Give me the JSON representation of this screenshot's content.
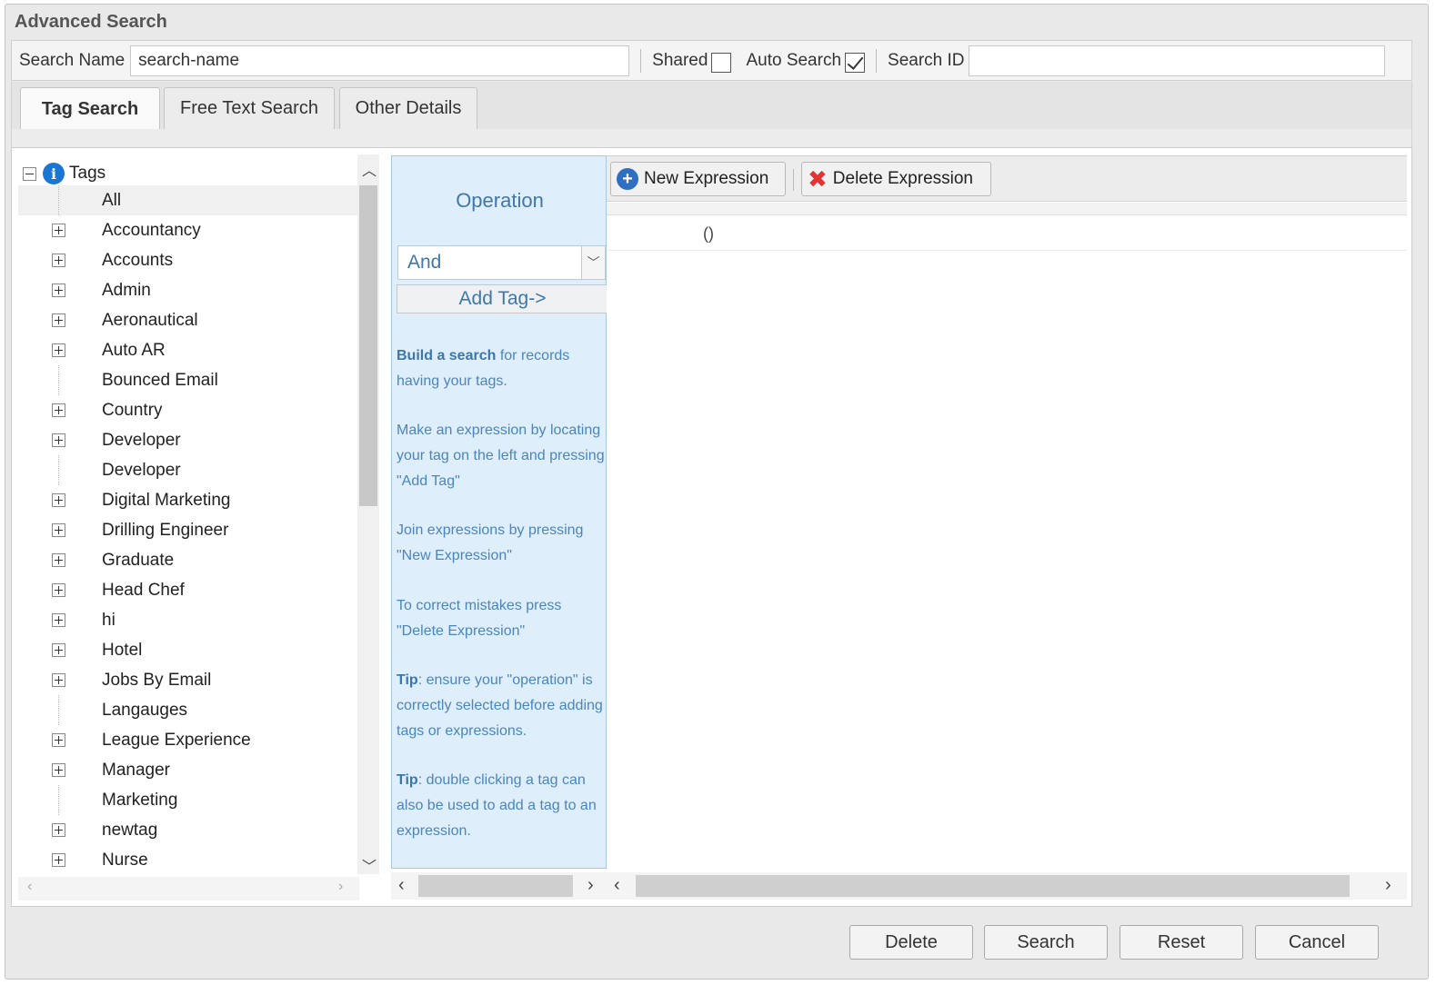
{
  "window": {
    "title": "Advanced Search"
  },
  "search_row": {
    "name_label": "Search Name",
    "name_value": "search-name",
    "shared_label": "Shared",
    "shared_checked": false,
    "auto_search_label": "Auto Search",
    "auto_search_checked": true,
    "search_id_label": "Search ID",
    "search_id_value": ""
  },
  "tabs": [
    {
      "label": "Tag Search",
      "active": true
    },
    {
      "label": "Free Text Search",
      "active": false
    },
    {
      "label": "Other Details",
      "active": false
    }
  ],
  "tree": {
    "root_label": "Tags",
    "items": [
      {
        "label": "All",
        "expandable": false,
        "selected": true
      },
      {
        "label": "Accountancy",
        "expandable": true
      },
      {
        "label": "Accounts",
        "expandable": true
      },
      {
        "label": "Admin",
        "expandable": true
      },
      {
        "label": "Aeronautical",
        "expandable": true
      },
      {
        "label": "Auto AR",
        "expandable": true
      },
      {
        "label": "Bounced Email",
        "expandable": false
      },
      {
        "label": "Country",
        "expandable": true
      },
      {
        "label": "Developer",
        "expandable": true
      },
      {
        "label": "Developer",
        "expandable": false
      },
      {
        "label": "Digital Marketing",
        "expandable": true
      },
      {
        "label": "Drilling Engineer",
        "expandable": true
      },
      {
        "label": "Graduate",
        "expandable": true
      },
      {
        "label": "Head Chef",
        "expandable": true
      },
      {
        "label": "hi",
        "expandable": true
      },
      {
        "label": "Hotel",
        "expandable": true
      },
      {
        "label": "Jobs By Email",
        "expandable": true
      },
      {
        "label": "Langauges",
        "expandable": false
      },
      {
        "label": "League Experience",
        "expandable": true
      },
      {
        "label": "Manager",
        "expandable": true
      },
      {
        "label": "Marketing",
        "expandable": false
      },
      {
        "label": "newtag",
        "expandable": true
      },
      {
        "label": "Nurse",
        "expandable": true
      }
    ]
  },
  "operation": {
    "title": "Operation",
    "selected": "And",
    "add_tag_label": "Add Tag->",
    "help": [
      {
        "bold": "Build a search",
        "text": " for records having your tags."
      },
      {
        "bold": "",
        "text": "Make an expression by locating your tag on the left and pressing \"Add Tag\""
      },
      {
        "bold": "",
        "text": "Join expressions by pressing \"New Expression\""
      },
      {
        "bold": "",
        "text": "To correct mistakes press \"Delete Expression\""
      },
      {
        "bold": "Tip",
        "text": ": ensure your \"operation\" is correctly selected before adding tags or expressions."
      },
      {
        "bold": "Tip",
        "text": ": double clicking a tag can also be used to add a tag to an expression."
      }
    ]
  },
  "expression": {
    "new_label": "New Expression",
    "delete_label": "Delete Expression",
    "rows": [
      "()"
    ]
  },
  "footer": {
    "delete_label": "Delete",
    "search_label": "Search",
    "reset_label": "Reset",
    "cancel_label": "Cancel"
  },
  "icons": {
    "info": "info-icon",
    "new_expression": "plus-circle-icon",
    "delete_expression": "red-x-icon"
  }
}
